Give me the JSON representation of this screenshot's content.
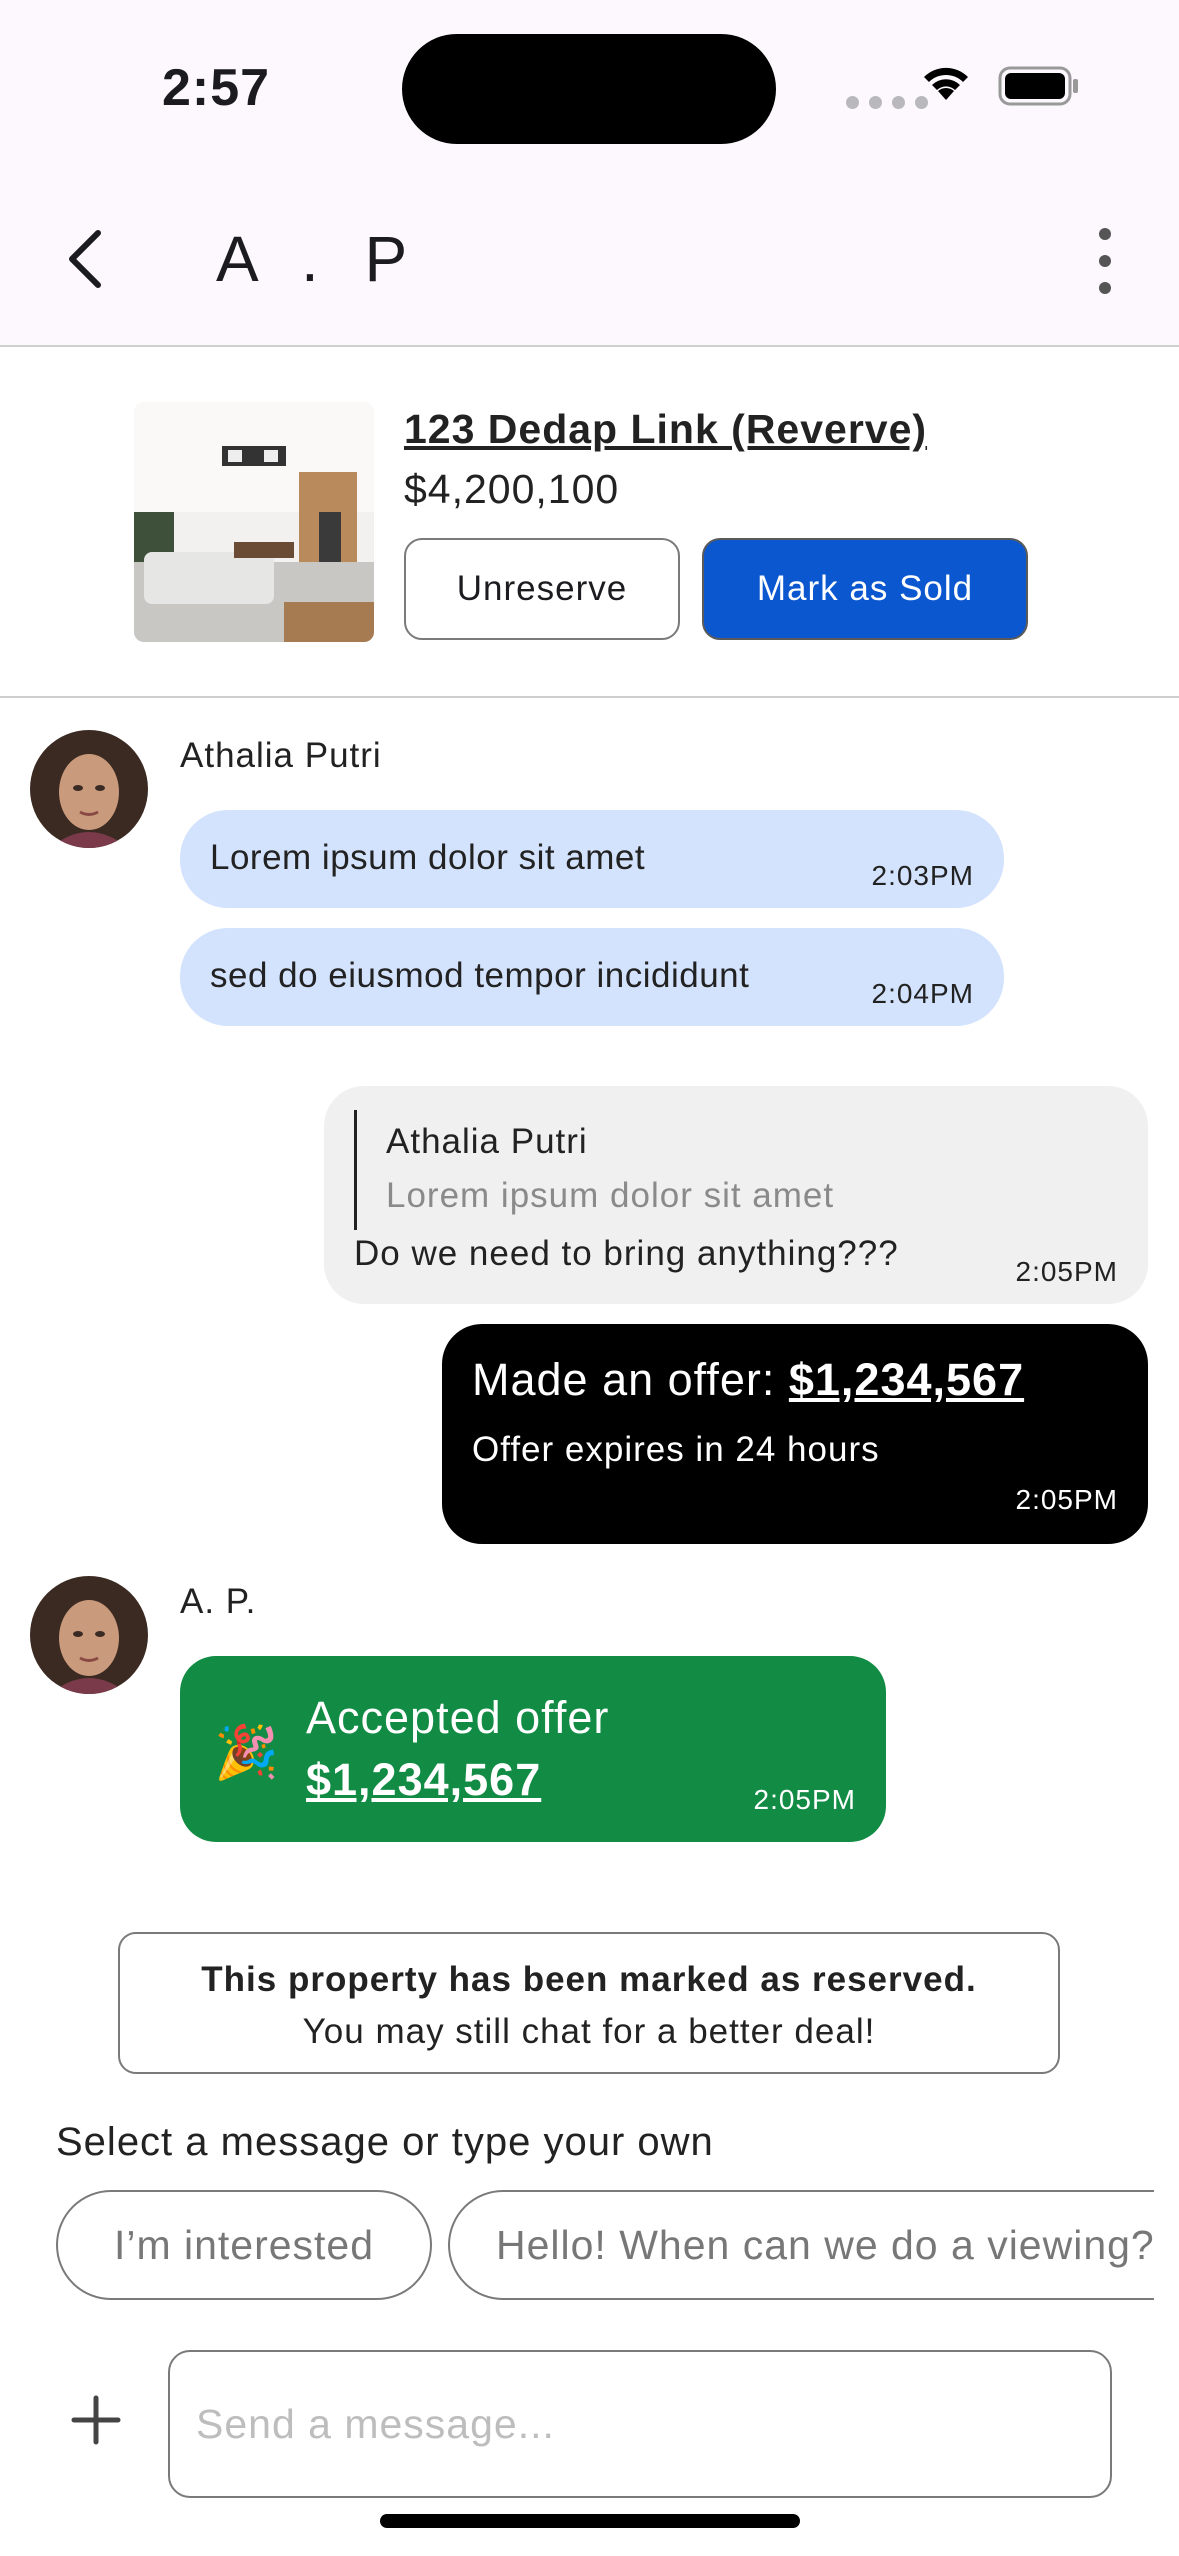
{
  "status_bar": {
    "time": "2:57"
  },
  "app_bar": {
    "title": "A . P"
  },
  "listing": {
    "title": "123 Dedap Link (Reverve)",
    "price": "$4,200,100",
    "unreserve_label": "Unreserve",
    "mark_sold_label": "Mark as Sold"
  },
  "messages": {
    "group1": {
      "sender": "Athalia Putri",
      "m1": {
        "text": "Lorem ipsum dolor sit amet",
        "time": "2:03PM"
      },
      "m2": {
        "text": "sed do eiusmod tempor incididunt",
        "time": "2:04PM"
      }
    },
    "reply": {
      "quoted_sender": "Athalia Putri",
      "quoted_text": "Lorem ipsum dolor sit amet",
      "text": "Do we need to bring anything???",
      "time": "2:05PM"
    },
    "offer": {
      "prefix": "Made an offer: ",
      "amount": "$1,234,567",
      "expiry": "Offer expires in 24 hours",
      "time": "2:05PM"
    },
    "group2": {
      "sender": "A. P.",
      "accept_label": "Accepted offer",
      "accept_amount": "$1,234,567",
      "accept_emoji": "🎉",
      "time": "2:05PM"
    }
  },
  "notice": {
    "line1": "This property has been marked as reserved.",
    "line2": "You may still chat for a better deal!"
  },
  "suggestions": {
    "label": "Select a message or type your own",
    "items": [
      "I’m interested",
      "Hello! When can we do a viewing?"
    ]
  },
  "composer": {
    "placeholder": "Send a message..."
  },
  "colors": {
    "incoming_bubble": "#d3e3fd",
    "outgoing_bubble": "#f0f0f0",
    "offer_bubble": "#000000",
    "accept_bubble": "#128c44",
    "primary": "#0b57d0"
  }
}
